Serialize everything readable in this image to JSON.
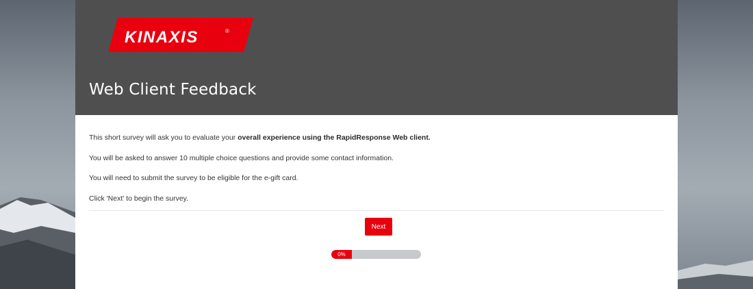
{
  "brand": {
    "logo_text": "KINAXIS",
    "logo_mark": "®",
    "accent_color": "#e8000f",
    "header_color": "#4f4f4f"
  },
  "header": {
    "title": "Web Client Feedback"
  },
  "intro": {
    "line1_prefix": "This short survey will ask you to evaluate your ",
    "line1_bold": "overall experience using the RapidResponse Web client.",
    "line2": "You will be asked to answer 10 multiple choice questions and provide some contact information.",
    "line3": "You will need to submit the survey to be eligible for the e-gift card.",
    "line4": "Click 'Next' to begin the survey."
  },
  "actions": {
    "next_label": "Next"
  },
  "progress": {
    "label": "0%",
    "value": 0
  }
}
